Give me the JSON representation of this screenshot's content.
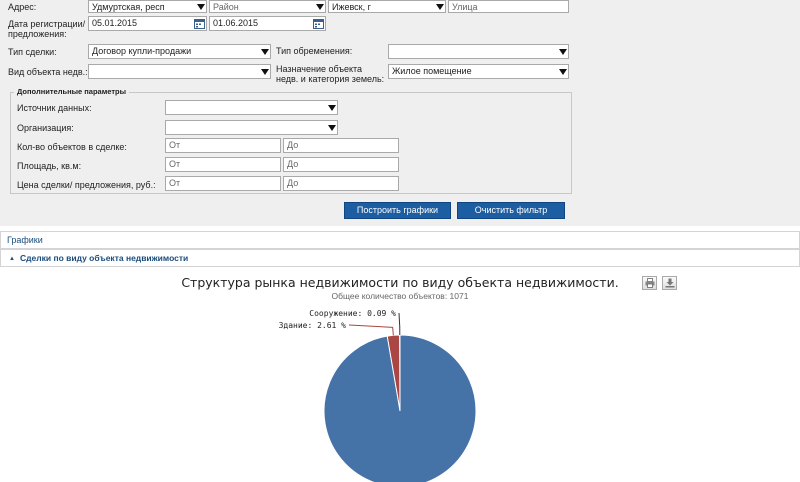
{
  "filters": {
    "address_label": "Адрес:",
    "region_value": "Удмуртская, респ",
    "district_placeholder": "Район",
    "city_value": "Ижевск, г",
    "street_placeholder": "Улица",
    "date_label_line1": "Дата регистрации/",
    "date_label_line2": "предложения:",
    "date_from": "05.01.2015",
    "date_to": "01.06.2015",
    "deal_type_label": "Тип сделки:",
    "deal_type_value": "Договор купли-продажи",
    "encumbrance_label": "Тип обременения:",
    "encumbrance_value": "",
    "object_type_label": "Вид объекта недв.:",
    "object_type_value": "",
    "purpose_label_line1": "Назначение объекта",
    "purpose_label_line2": "недв. и категория земель:",
    "purpose_value": "Жилое помещение"
  },
  "additional": {
    "title": "Дополнительные параметры",
    "source_label": "Источник данных:",
    "source_value": "",
    "org_label": "Организация:",
    "org_value": "",
    "count_label": "Кол-во объектов в сделке:",
    "area_label": "Площадь, кв.м:",
    "price_label": "Цена сделки/ предложения, руб.:",
    "from_placeholder": "От",
    "to_placeholder": "До"
  },
  "buttons": {
    "build": "Построить графики",
    "clear": "Очистить фильтр"
  },
  "sections": {
    "graphs": "Графики",
    "deals_by_type": "Сделки по виду объекта недвижимости"
  },
  "chart_data": {
    "type": "pie",
    "title": "Структура рынка недвижимости по виду объекта недвижимости.",
    "subtitle": "Общее количество объектов: 1071",
    "slices": [
      {
        "label": "Сооружение: 0.09 %",
        "value": 0.09,
        "color": "#4572a7"
      },
      {
        "label": "Здание: 2.61 %",
        "value": 2.61,
        "color": "#aa4643"
      },
      {
        "label": "",
        "value": 97.3,
        "color": "#4572a7"
      }
    ]
  },
  "colors": {
    "accent": "#1d5ea3",
    "pie_primary": "#4572a7",
    "pie_secondary": "#aa4643"
  }
}
